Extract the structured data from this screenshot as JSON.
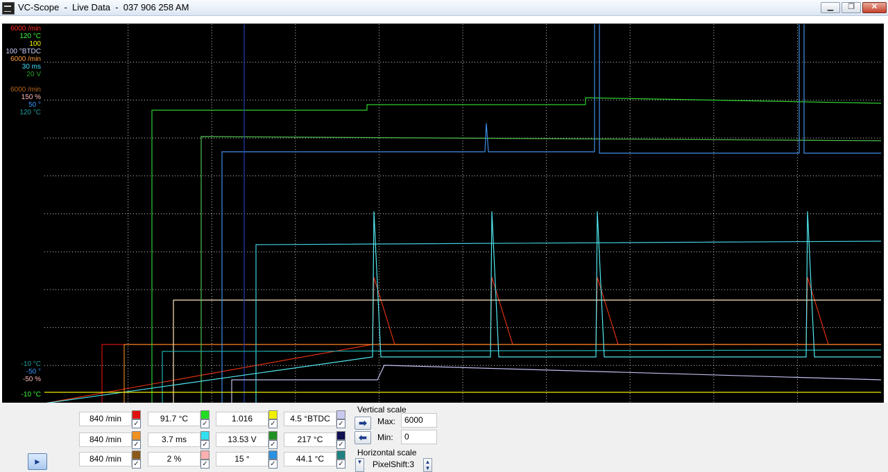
{
  "window": {
    "title": "VC-Scope  -  Live Data  -  037 906 258 AM",
    "minimize": "▁",
    "maximize": "❐",
    "close": "✕"
  },
  "scope": {
    "top_labels": [
      {
        "text": "6000 /min",
        "color": "#ff2a2a"
      },
      {
        "text": "120 °C",
        "color": "#3cff3c"
      },
      {
        "text": "100",
        "color": "#ffff00"
      },
      {
        "text": "100 °BTDC",
        "color": "#d0d0ff"
      },
      {
        "text": "6000 /min",
        "color": "#ff9a40"
      },
      {
        "text": "30 ms",
        "color": "#40e0ff"
      },
      {
        "text": "20 V",
        "color": "#2ca02c"
      },
      {
        "text": "",
        "color": "#000000"
      },
      {
        "text": "6000 /min",
        "color": "#b5651d"
      },
      {
        "text": "150 %",
        "color": "#ffb6b6"
      },
      {
        "text": "50 °",
        "color": "#3399ff"
      },
      {
        "text": "120 °C",
        "color": "#20a0a0"
      }
    ],
    "bottom_labels": [
      {
        "text": "-10 °C",
        "color": "#20a0a0"
      },
      {
        "text": "-50 °",
        "color": "#3399ff"
      },
      {
        "text": "-50 %",
        "color": "#ffb6b6"
      },
      {
        "text": "-10 °C",
        "color": "#3cff3c"
      }
    ]
  },
  "channels": [
    {
      "value": "840 /min",
      "color": "#e01010"
    },
    {
      "value": "91.7 °C",
      "color": "#22dd22"
    },
    {
      "value": "1.016",
      "color": "#f0f000"
    },
    {
      "value": "4.5 °BTDC",
      "color": "#c8c8f0"
    },
    {
      "value": "840 /min",
      "color": "#f09020"
    },
    {
      "value": "3.7 ms",
      "color": "#30e0f0"
    },
    {
      "value": "13.53 V",
      "color": "#209020"
    },
    {
      "value": "217 °C",
      "color": "#101050"
    },
    {
      "value": "840 /min",
      "color": "#8b5a1a"
    },
    {
      "value": "2 %",
      "color": "#ffb0b0"
    },
    {
      "value": "15 °",
      "color": "#2a90e0"
    },
    {
      "value": "44.1 °C",
      "color": "#208080"
    }
  ],
  "vertical_scale": {
    "title": "Vertical scale",
    "max_label": "Max:",
    "max_value": "6000",
    "min_label": "Min:",
    "min_value": "0"
  },
  "horizontal_scale": {
    "title": "Horizontal scale",
    "value": "PixelShift:3"
  },
  "play_icon": "play-icon",
  "play_glyph": "►"
}
